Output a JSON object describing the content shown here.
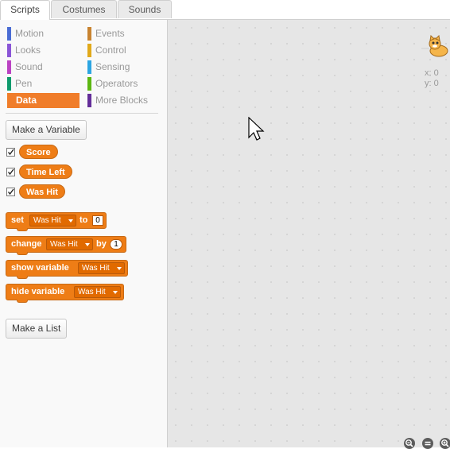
{
  "tabs": [
    "Scripts",
    "Costumes",
    "Sounds"
  ],
  "categories": {
    "left": [
      {
        "label": "Motion",
        "color": "#4a6cd4"
      },
      {
        "label": "Looks",
        "color": "#8a55d7"
      },
      {
        "label": "Sound",
        "color": "#bb42c3"
      },
      {
        "label": "Pen",
        "color": "#0e9a6c"
      },
      {
        "label": "Data",
        "color": "#ee7d16",
        "selected": true
      }
    ],
    "right": [
      {
        "label": "Events",
        "color": "#c88330"
      },
      {
        "label": "Control",
        "color": "#e1a91a"
      },
      {
        "label": "Sensing",
        "color": "#2ca5e2"
      },
      {
        "label": "Operators",
        "color": "#5cb712"
      },
      {
        "label": "More Blocks",
        "color": "#632d99"
      }
    ]
  },
  "buttons": {
    "make_variable": "Make a Variable",
    "make_list": "Make a List"
  },
  "variables": [
    "Score",
    "Time Left",
    "Was Hit"
  ],
  "blocks": {
    "set": {
      "label": "set",
      "var": "Was Hit",
      "mid": "to",
      "value": "0"
    },
    "change": {
      "label": "change",
      "var": "Was Hit",
      "mid": "by",
      "value": "1"
    },
    "show": {
      "label": "show variable",
      "var": "Was Hit"
    },
    "hide": {
      "label": "hide variable",
      "var": "Was Hit"
    }
  },
  "stage": {
    "x_label": "x:",
    "x_value": "0",
    "y_label": "y:",
    "y_value": "0"
  }
}
